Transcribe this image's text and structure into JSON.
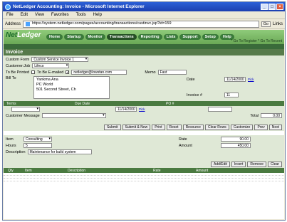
{
  "window": {
    "title": "NetLedger Accounting: Invoice - Microsoft Internet Explorer",
    "controls": [
      "_",
      "□",
      "×"
    ]
  },
  "menu": [
    "File",
    "Edit",
    "View",
    "Favorites",
    "Tools",
    "Help"
  ],
  "address_bar": {
    "label": "Address",
    "url": "https://system.netledger.com/pages/accounting/transactions/custinvc.jsp?id=159",
    "go": "Go",
    "links": "Links"
  },
  "app": {
    "logo_prefix": "Net",
    "logo_suffix": "Ledger",
    "tabs": [
      "Home",
      "Startup",
      "Monitor",
      "Transactions",
      "Reporting",
      "Lists",
      "Support",
      "Setup",
      "Help"
    ],
    "active_tab": "Transactions",
    "header_links": "* Go To Register  * Go To Recent",
    "subtabs": [
      "",
      ""
    ]
  },
  "invoice": {
    "section_title": "Invoice",
    "custom_form_label": "Custom Form",
    "custom_form_value": "Custom Service Invoice 1",
    "customer_job_label": "Customer:Job",
    "customer_job_value": "Lifeco",
    "to_be_printed_label": "To Be Printed",
    "to_be_emailed_label": "To Be E-mailed",
    "email_value": "netledger@lowstan.com",
    "memo_label": "Memo",
    "memo_value": "Fast",
    "bill_to_label": "Bill To",
    "bill_to_lines": [
      "Yankma Ana",
      "PC World",
      "501 Second Street, Ch"
    ],
    "date_label": "Date",
    "date_value": "11/14/2000",
    "date_pick": "Pick",
    "invoice_no_label": "Invoice #",
    "invoice_no_value": "11",
    "terms_label": "Terms",
    "due_date_label": "Due Date",
    "due_date_value": "11/14/2000",
    "due_date_pick": "Pick",
    "po_label": "PO #",
    "customer_message_label": "Customer Message",
    "total_label": "Total",
    "total_value": "0.00"
  },
  "action_buttons": [
    "Submit",
    "Submit & New",
    "Print",
    "Reset",
    "Resource",
    "Clear Rows",
    "Customize",
    "Prev",
    "Next"
  ],
  "line_item": {
    "item_label": "Item",
    "item_value": "Consulting",
    "hours_label": "Hours",
    "hours_value": "5",
    "rate_label": "Rate",
    "rate_value": "90.00",
    "amount_label": "Amount",
    "amount_value": "450.00",
    "description_label": "Description",
    "description_value": "Maintenance for build system"
  },
  "line_buttons": [
    "Add/Edit",
    "Insert",
    "Remove",
    "Clear"
  ],
  "grid_headers": [
    "Qty",
    "Item",
    "Description",
    "Rate",
    "Amount"
  ]
}
